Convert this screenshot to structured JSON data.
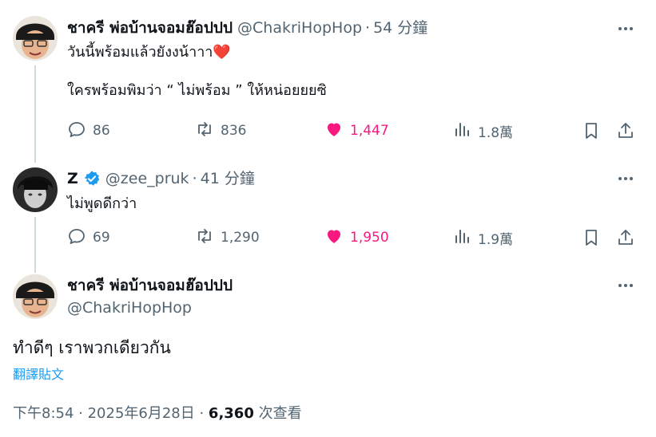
{
  "tweet1": {
    "name": "ชาครี พ่อบ้านจอมฮ๊อปปป",
    "handle": "@ChakriHopHop",
    "separator": "·",
    "time": "54 分鐘",
    "text": "วันนี้พร้อมแล้วยังงน้าาา❤️\n\nใครพร้อมพิมว่า “ ไม่พร้อม ” ให้หน่อยยยซิ",
    "replies": "86",
    "retweets": "836",
    "likes": "1,447",
    "views": "1.8萬"
  },
  "tweet2": {
    "name": "Z",
    "handle": "@zee_pruk",
    "separator": "·",
    "time": "41 分鐘",
    "text": "ไม่พูดดีกว่า",
    "replies": "69",
    "retweets": "1,290",
    "likes": "1,950",
    "views": "1.9萬"
  },
  "main": {
    "name": "ชาครี พ่อบ้านจอมฮ๊อปปป",
    "handle": "@ChakriHopHop",
    "text": "ทำดีๆ เราพวกเดียวกัน",
    "translate": "翻譯貼文",
    "timestamp": "下午8:54 · 2025年6月28日 · ",
    "views_count": "6,360",
    "views_label": " 次查看"
  },
  "colors": {
    "accent": "#1d9bf0",
    "like": "#f91880",
    "muted": "#536471"
  },
  "icons": [
    "reply-icon",
    "retweet-icon",
    "like-icon",
    "views-icon",
    "bookmark-icon",
    "share-icon",
    "more-icon",
    "verified-icon"
  ]
}
